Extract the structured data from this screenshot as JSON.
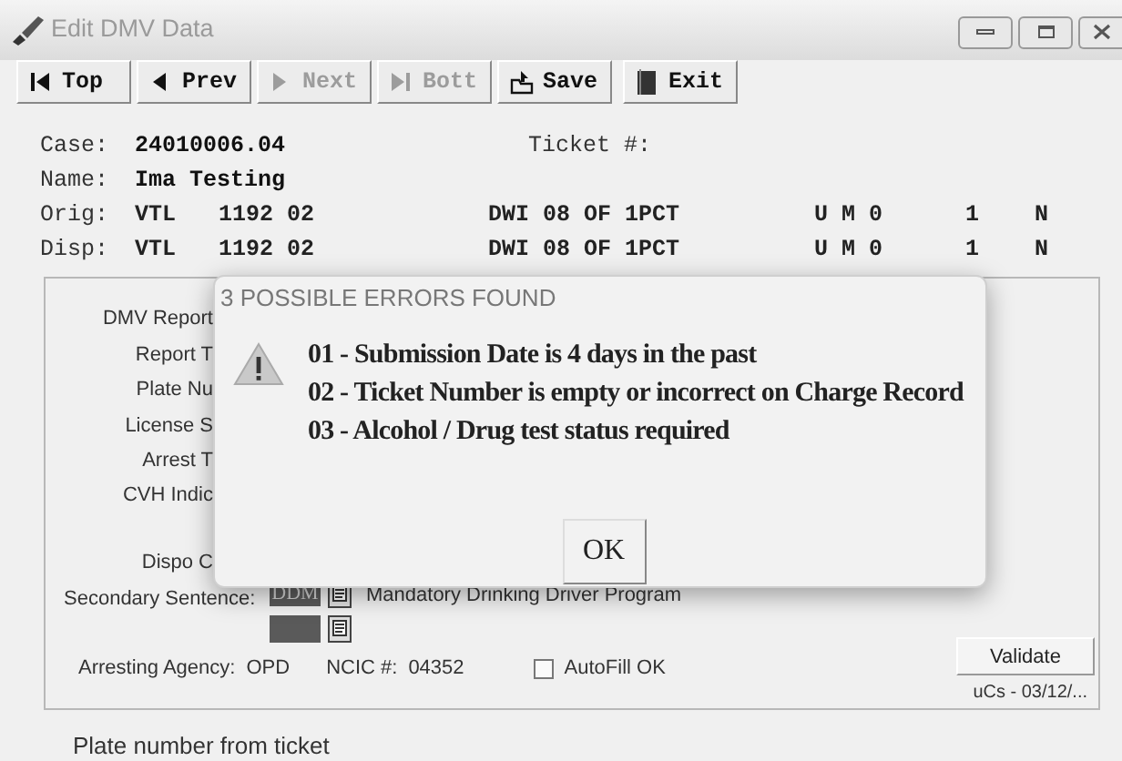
{
  "window": {
    "title": "Edit DMV Data"
  },
  "toolbar": [
    {
      "label": "Top",
      "kind": "first",
      "disabled": false
    },
    {
      "label": "Prev",
      "kind": "prev",
      "disabled": false
    },
    {
      "label": "Next",
      "kind": "next",
      "disabled": true
    },
    {
      "label": "Bott",
      "kind": "last",
      "disabled": true
    },
    {
      "label": "Save",
      "kind": "save",
      "disabled": false
    },
    {
      "label": "Exit",
      "kind": "exit",
      "disabled": false
    }
  ],
  "record": {
    "case_label": "Case:",
    "case": "24010006.04",
    "ticket_label": "Ticket #:",
    "name_label": "Name:",
    "name": "Ima Testing",
    "charges": [
      {
        "label": "Orig:",
        "code": "VTL",
        "section": "1192 02",
        "description": "DWI 08 OF 1PCT",
        "column_4": "U M 0",
        "column_5": "1",
        "column_6": "N"
      },
      {
        "label": "Disp:",
        "code": "VTL",
        "section": "1192 02",
        "description": "DWI 08 OF 1PCT",
        "column_4": "U M 0",
        "column_5": "1",
        "column_6": "N"
      }
    ]
  },
  "form": {
    "labels": [
      "DMV Report",
      "Report T",
      "Plate Nu",
      "License S",
      "Arrest T",
      "CVH Indic"
    ],
    "dispo_label": "Dispo C",
    "secondary_sentence": {
      "label": "Secondary Sentence:",
      "entries": [
        {
          "kind": "coded",
          "code": "DDM",
          "description": "Mandatory Drinking Driver Program"
        },
        {
          "kind": "blank"
        }
      ]
    },
    "arresting_agency": {
      "label": "Arresting Agency:",
      "value": "OPD"
    },
    "ncic": {
      "label": "NCIC #:",
      "value": "04352"
    },
    "autofill": {
      "label": "AutoFill OK",
      "checked": false
    },
    "validate_button": "Validate",
    "footer_note": "uCs - 03/12/..."
  },
  "status_bar": "Plate number from ticket",
  "dialog": {
    "title": "3 POSSIBLE ERRORS FOUND",
    "messages": [
      "01 - Submission Date is 4 days in the past",
      "02 - Ticket Number is empty or incorrect on Charge Record",
      "03 - Alcohol / Drug test status required"
    ],
    "button": "OK"
  }
}
